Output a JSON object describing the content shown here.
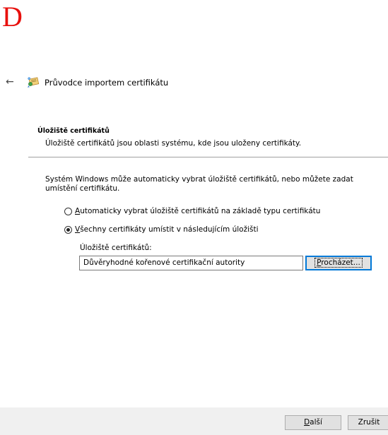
{
  "corner_letter": "D",
  "header": {
    "back_icon": "back-arrow-icon",
    "wizard_icon": "certificate-wizard-icon",
    "title": "Průvodce importem certifikátu"
  },
  "section": {
    "title": "Úložiště certifikátů",
    "description": "Úložiště certifikátů jsou oblasti systému, kde jsou uloženy certifikáty."
  },
  "intro": "Systém Windows může automaticky vybrat úložiště certifikátů, nebo můžete zadat umístění certifikátu.",
  "options": [
    {
      "accel": "A",
      "rest": "utomaticky vybrat úložiště certifikátů na základě typu certifikátu",
      "checked": false
    },
    {
      "accel": "V",
      "rest": "šechny certifikáty umístit v následujícím úložišti",
      "checked": true
    }
  ],
  "store": {
    "label": "Úložiště certifikátů:",
    "value": "Důvěryhodné kořenové certifikační autority",
    "browse_accel": "P",
    "browse_rest": "rocházet..."
  },
  "footer": {
    "next_accel": "D",
    "next_rest": "alší",
    "cancel": "Zrušit"
  },
  "colors": {
    "letter": "#e8100d",
    "focus_border": "#0078d7",
    "footer_bg": "#f0f0f0"
  }
}
